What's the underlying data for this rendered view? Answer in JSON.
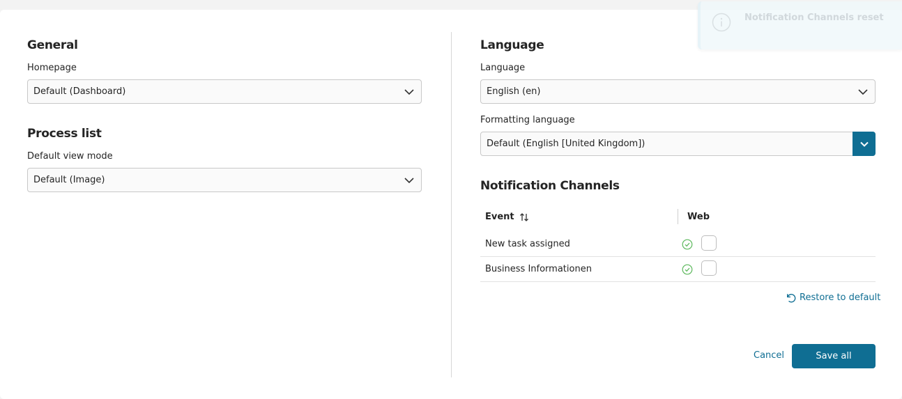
{
  "general": {
    "heading": "General",
    "homepage_label": "Homepage",
    "homepage_value": "Default (Dashboard)"
  },
  "process_list": {
    "heading": "Process list",
    "view_mode_label": "Default view mode",
    "view_mode_value": "Default (Image)"
  },
  "language": {
    "heading": "Language",
    "language_label": "Language",
    "language_value": "English (en)",
    "formatting_label": "Formatting language",
    "formatting_value": "Default (English [United Kingdom])"
  },
  "notifications": {
    "heading": "Notification Channels",
    "columns": {
      "event": "Event",
      "web": "Web"
    },
    "rows": [
      {
        "event": "New task assigned",
        "web_checked": false
      },
      {
        "event": "Business Informationen",
        "web_checked": false
      }
    ],
    "restore_label": "Restore to default"
  },
  "actions": {
    "cancel": "Cancel",
    "save": "Save all"
  },
  "toast": {
    "message": "Notification Channels reset"
  },
  "colors": {
    "accent": "#0f6e93",
    "success": "#5cb85c",
    "divider": "#d6d6d6"
  }
}
